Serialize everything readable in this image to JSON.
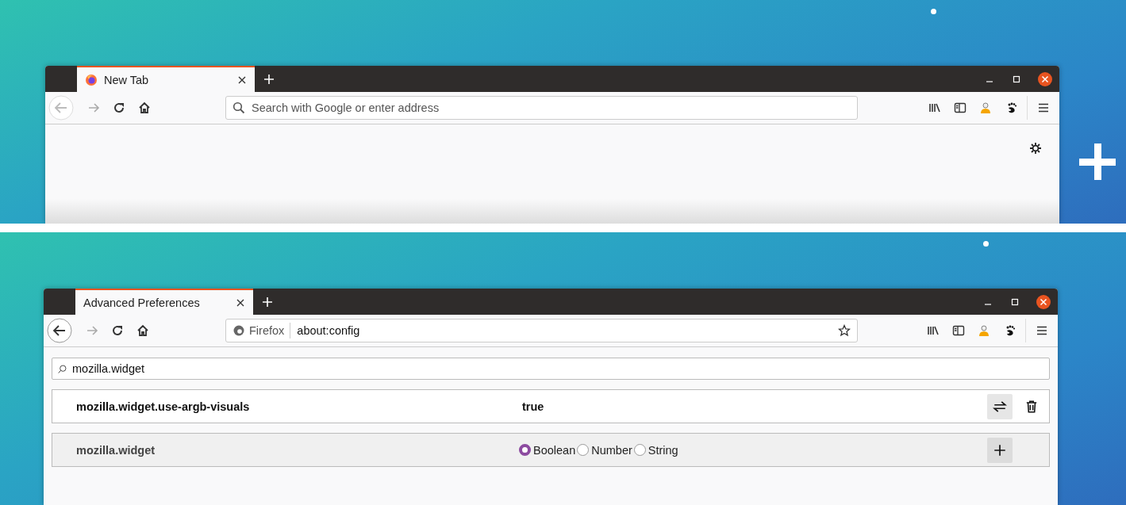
{
  "windows": [
    {
      "kind": "new-tab",
      "tabs": [
        {
          "title": "New Tab",
          "selected": true,
          "favicon": true
        }
      ],
      "back_disabled": true,
      "forward_disabled": true,
      "address": {
        "placeholder": "Search with Google or enter address"
      }
    },
    {
      "kind": "config",
      "tabs": [
        {
          "title": "Advanced Preferences",
          "selected": true,
          "favicon": false
        }
      ],
      "back_disabled": false,
      "forward_disabled": true,
      "address": {
        "identity": "Firefox",
        "value": "about:config"
      },
      "config": {
        "search": "mozilla.widget",
        "prefs": [
          {
            "kind": "existing",
            "name": "mozilla.widget.use-argb-visuals",
            "value": "true"
          },
          {
            "kind": "new",
            "name": "mozilla.widget",
            "types": [
              {
                "label": "Boolean",
                "selected": true
              },
              {
                "label": "Number",
                "selected": false
              },
              {
                "label": "String",
                "selected": false
              }
            ]
          }
        ]
      }
    }
  ]
}
